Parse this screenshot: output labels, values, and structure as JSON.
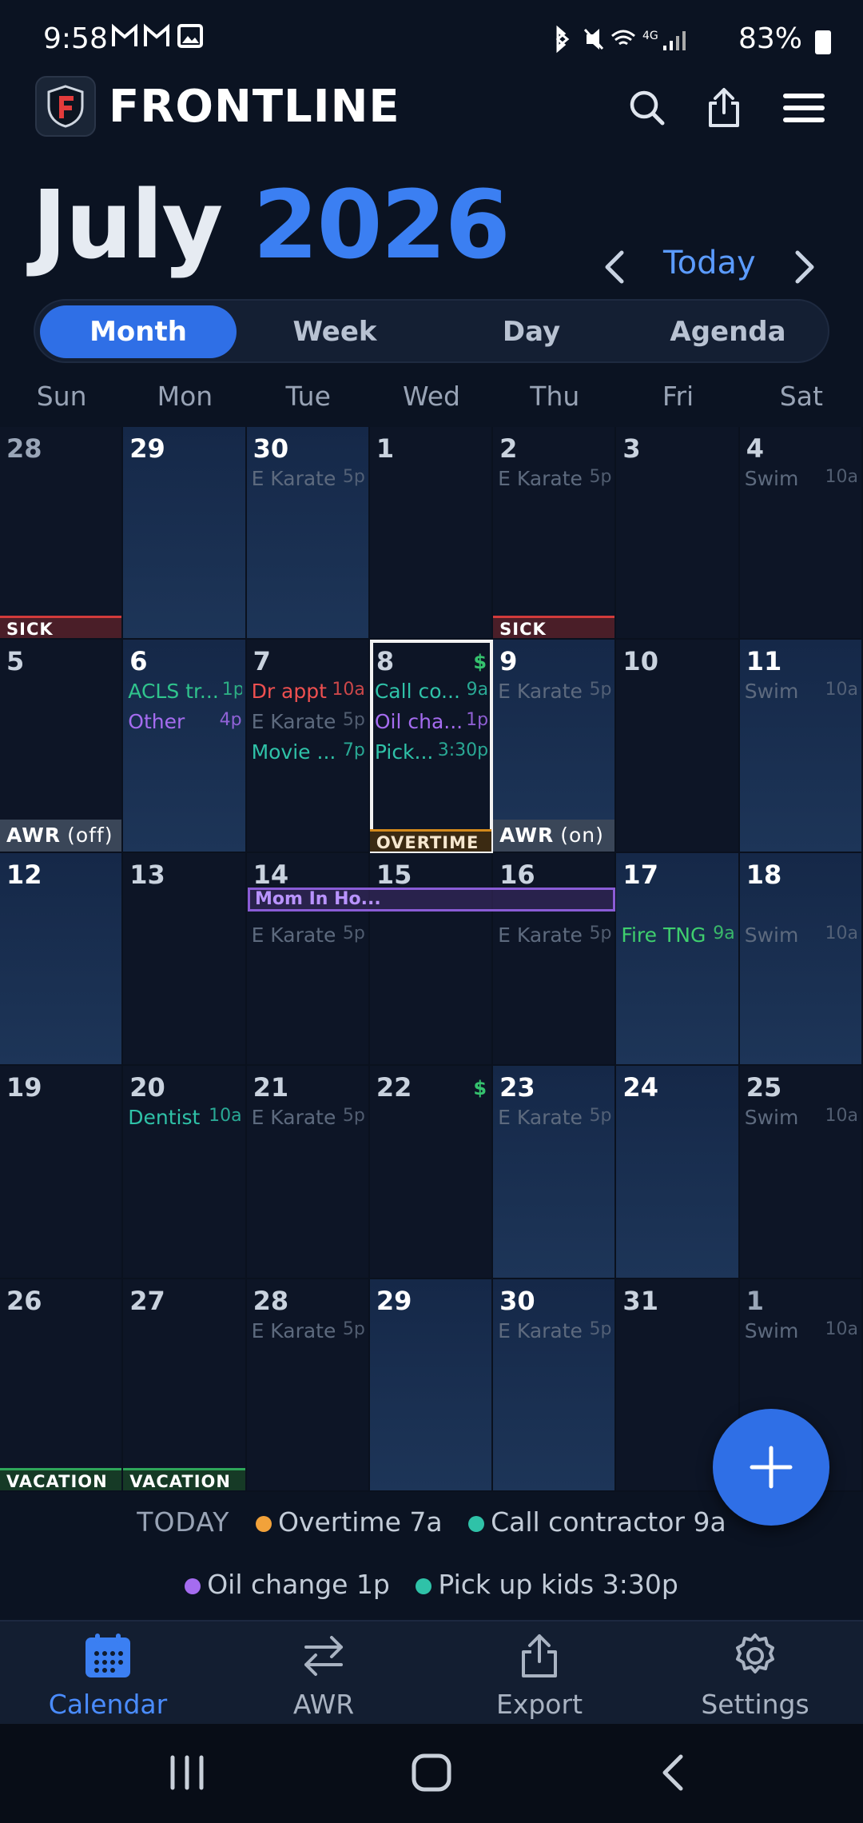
{
  "status_bar": {
    "time": "9:58",
    "battery": "83%"
  },
  "app": {
    "name": "FRONTLINE"
  },
  "header": {
    "month": "July",
    "year": "2026",
    "today_label": "Today"
  },
  "view_tabs": [
    {
      "label": "Month",
      "active": true
    },
    {
      "label": "Week",
      "active": false
    },
    {
      "label": "Day",
      "active": false
    },
    {
      "label": "Agenda",
      "active": false
    }
  ],
  "weekdays": [
    "Sun",
    "Mon",
    "Tue",
    "Wed",
    "Thu",
    "Fri",
    "Sat"
  ],
  "weeks": [
    [
      {
        "day": "28",
        "dim": true,
        "shade": "lo",
        "band": {
          "type": "sick",
          "label": "SICK"
        }
      },
      {
        "day": "29",
        "shade": "hi"
      },
      {
        "day": "30",
        "shade": "hi",
        "events": [
          {
            "title": "E Karate",
            "time": "5p",
            "color": "gray"
          }
        ]
      },
      {
        "day": "1",
        "shade": "lo"
      },
      {
        "day": "2",
        "shade": "lo",
        "events": [
          {
            "title": "E Karate",
            "time": "5p",
            "color": "gray"
          }
        ],
        "band": {
          "type": "sick",
          "label": "SICK"
        }
      },
      {
        "day": "3",
        "shade": "lo"
      },
      {
        "day": "4",
        "shade": "lo",
        "events": [
          {
            "title": "Swim",
            "time": "10a",
            "color": "gray"
          }
        ]
      }
    ],
    [
      {
        "day": "5",
        "shade": "lo",
        "band": {
          "type": "awr",
          "label": "AWR",
          "note": "(off)"
        }
      },
      {
        "day": "6",
        "shade": "hi",
        "events": [
          {
            "title": "ACLS tr...",
            "time": "1p",
            "color": "green"
          },
          {
            "title": "Other",
            "time": "4p",
            "color": "purple"
          }
        ]
      },
      {
        "day": "7",
        "shade": "lo",
        "events": [
          {
            "title": "Dr appt",
            "time": "10a",
            "color": "red"
          },
          {
            "title": "E Karate",
            "time": "5p",
            "color": "gray"
          },
          {
            "title": "Movie ...",
            "time": "7p",
            "color": "teal"
          }
        ]
      },
      {
        "day": "8",
        "shade": "lo",
        "selected": true,
        "dollar": "$",
        "events": [
          {
            "title": "Call co...",
            "time": "9a",
            "color": "teal"
          },
          {
            "title": "Oil cha...",
            "time": "1p",
            "color": "purple"
          },
          {
            "title": "Pick...",
            "time": "3:30p",
            "color": "teal"
          }
        ],
        "band": {
          "type": "ot",
          "label": "OVERTIME"
        }
      },
      {
        "day": "9",
        "shade": "hi",
        "events": [
          {
            "title": "E Karate",
            "time": "5p",
            "color": "gray"
          }
        ],
        "band": {
          "type": "awr",
          "label": "AWR",
          "note": "(on)"
        }
      },
      {
        "day": "10",
        "shade": "lo"
      },
      {
        "day": "11",
        "shade": "hi",
        "events": [
          {
            "title": "Swim",
            "time": "10a",
            "color": "gray"
          }
        ]
      }
    ],
    [
      {
        "day": "12",
        "shade": "hi"
      },
      {
        "day": "13",
        "shade": "lo"
      },
      {
        "day": "14",
        "shade": "lo",
        "events": [
          {
            "title": "",
            "time": "",
            "color": "gray"
          },
          {
            "title": "E Karate",
            "time": "5p",
            "color": "gray"
          }
        ]
      },
      {
        "day": "15",
        "shade": "lo"
      },
      {
        "day": "16",
        "shade": "lo",
        "events": [
          {
            "title": "",
            "time": "",
            "color": "gray"
          },
          {
            "title": "E Karate",
            "time": "5p",
            "color": "gray"
          }
        ]
      },
      {
        "day": "17",
        "shade": "hi",
        "events": [
          {
            "title": "",
            "time": "",
            "color": "gray"
          },
          {
            "title": "Fire TNG",
            "time": "9a",
            "color": "lime"
          }
        ]
      },
      {
        "day": "18",
        "shade": "hi",
        "events": [
          {
            "title": "",
            "time": "",
            "color": "gray"
          },
          {
            "title": "Swim",
            "time": "10a",
            "color": "gray"
          }
        ]
      }
    ],
    [
      {
        "day": "19",
        "shade": "lo"
      },
      {
        "day": "20",
        "shade": "lo",
        "events": [
          {
            "title": "Dentist",
            "time": "10a",
            "color": "teal"
          }
        ]
      },
      {
        "day": "21",
        "shade": "lo",
        "events": [
          {
            "title": "E Karate",
            "time": "5p",
            "color": "gray"
          }
        ]
      },
      {
        "day": "22",
        "shade": "lo",
        "dollar": "$"
      },
      {
        "day": "23",
        "shade": "hi",
        "events": [
          {
            "title": "E Karate",
            "time": "5p",
            "color": "gray"
          }
        ]
      },
      {
        "day": "24",
        "shade": "hi"
      },
      {
        "day": "25",
        "shade": "lo",
        "events": [
          {
            "title": "Swim",
            "time": "10a",
            "color": "gray"
          }
        ]
      }
    ],
    [
      {
        "day": "26",
        "shade": "lo",
        "band": {
          "type": "vac",
          "label": "VACATION"
        }
      },
      {
        "day": "27",
        "shade": "lo",
        "band": {
          "type": "vac",
          "label": "VACATION"
        }
      },
      {
        "day": "28",
        "shade": "lo",
        "events": [
          {
            "title": "E Karate",
            "time": "5p",
            "color": "gray"
          }
        ]
      },
      {
        "day": "29",
        "shade": "hi"
      },
      {
        "day": "30",
        "shade": "hi",
        "events": [
          {
            "title": "E Karate",
            "time": "5p",
            "color": "gray"
          }
        ]
      },
      {
        "day": "31",
        "shade": "lo"
      },
      {
        "day": "1",
        "dim": true,
        "shade": "lo",
        "events": [
          {
            "title": "Swim",
            "time": "10a",
            "color": "gray"
          }
        ]
      }
    ]
  ],
  "multi_day_event": {
    "title": "Mom In Ho..."
  },
  "today_summary": {
    "label": "TODAY",
    "items": [
      {
        "text": "Overtime 7a",
        "color": "#f2a23a"
      },
      {
        "text": "Call contractor 9a",
        "color": "#2fc2a8"
      },
      {
        "text": "Oil change 1p",
        "color": "#a56cf0"
      },
      {
        "text": "Pick up kids 3:30p",
        "color": "#2fc2a8"
      }
    ]
  },
  "bottom_nav": [
    {
      "label": "Calendar",
      "icon": "calendar-icon",
      "active": true
    },
    {
      "label": "AWR",
      "icon": "swap-icon",
      "active": false
    },
    {
      "label": "Export",
      "icon": "export-icon",
      "active": false
    },
    {
      "label": "Settings",
      "icon": "gear-icon",
      "active": false
    }
  ],
  "colors": {
    "accent": "#2f6fe6",
    "background": "#0b1322"
  }
}
